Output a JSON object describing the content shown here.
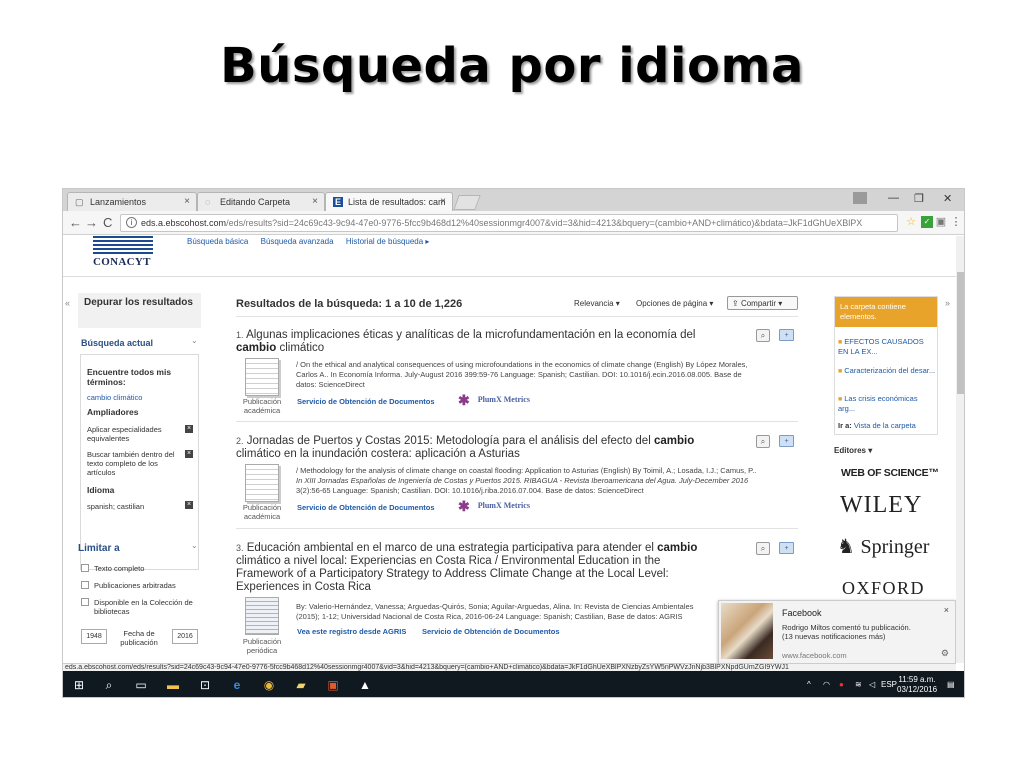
{
  "slide": {
    "title": "Búsqueda por idioma"
  },
  "browser": {
    "tabs": [
      {
        "label": "Lanzamientos",
        "close": "×"
      },
      {
        "label": "Editando Carpeta",
        "close": "×"
      },
      {
        "label": "Lista de resultados: cam",
        "close": "×"
      }
    ],
    "window_controls": {
      "minimize": "—",
      "maximize": "❐",
      "close": "✕"
    },
    "nav": {
      "back": "←",
      "forward": "→",
      "reload": "C"
    },
    "url_host": "eds.a.ebscohost.com",
    "url_path": "/eds/results?sid=24c69c43-9c94-47e0-9776-5fcc9b468d12%40sessionmgr4007&vid=3&hid=4213&bquery=(cambio+AND+climático)&bdata=JkF1dGhUeXBlPX"
  },
  "site": {
    "logo_text": "CONACYT",
    "top_links": [
      "Búsqueda básica",
      "Búsqueda avanzada",
      "Historial de búsqueda ▸"
    ]
  },
  "sidebar": {
    "collapse": "«",
    "refine_title": "Depurar los resultados",
    "current_search_title": "Búsqueda actual",
    "find_all_label": "Encuentre todos mis términos:",
    "term": "cambio climático",
    "expanders_label": "Ampliadores",
    "expanders": [
      "Aplicar especialidades equivalentes",
      "Buscar también dentro del texto completo de los artículos"
    ],
    "language_label": "Idioma",
    "language_value": "spanish; castilian",
    "limit_title": "Limitar a",
    "limits": [
      "Texto completo",
      "Publicaciones arbitradas",
      "Disponible en la Colección de bibliotecas"
    ],
    "year_from": "1948",
    "year_label": "Fecha de publicación",
    "year_to": "2016",
    "caret": "⌄",
    "remove": "×"
  },
  "results": {
    "header": "Resultados de la búsqueda: 1 a 10 de 1,226",
    "sort": "Relevancia ▾",
    "page_options": "Opciones de página ▾",
    "share": "Compartir ▾",
    "items": [
      {
        "num": "1.",
        "title_a": "Algunas implicaciones éticas y analíticas de la microfundamentación en la economía del ",
        "title_bold": "cambio",
        "title_b": " climático",
        "meta_1": "/ On the ethical and analytical consequences of using microfoundations in the economics of climate change (English) By López Morales,",
        "meta_2": "Carlos A.. In Economía Informa. July-August 2016 399:59-76 Language: Spanish; Castilian. DOI: 10.1016/j.ecin.2016.08.005. Base de",
        "meta_3": "datos: ScienceDirect",
        "pubtype": "Publicación académica",
        "link_1": "Servicio de Obtención de Documentos",
        "link_2": "PlumX Metrics"
      },
      {
        "num": "2.",
        "title_a": "Jornadas de Puertos y Costas 2015: Metodología para el análisis del efecto del ",
        "title_bold": "cambio",
        "title_b": " climático en la inundación costera: aplicación a Asturias",
        "meta_1": "/ Methodology for the analysis of climate change on coastal flooding: Application to Asturias (English) By Toimil, A.; Losada, I.J.; Camus, P..",
        "meta_2": "In XIII Jornadas Españolas de Ingeniería de Costas y Puertos 2015. RIBAGUA - Revista Iberoamericana del Agua. July-December 2016",
        "meta_3": "3(2):56-65 Language: Spanish; Castilian. DOI: 10.1016/j.riba.2016.07.004. Base de datos: ScienceDirect",
        "pubtype": "Publicación académica",
        "link_1": "Servicio de Obtención de Documentos",
        "link_2": "PlumX Metrics"
      },
      {
        "num": "3.",
        "title_a": "Educación ambiental en el marco de una estrategia participativa para atender el ",
        "title_bold": "cambio",
        "title_b": " climático a nivel local: Experiencias en Costa Rica / Environmental Education in the Framework of a Participatory Strategy to Address Climate Change at the Local Level: Experiences in Costa Rica",
        "meta_1": "By: Valerio-Hernández, Vanessa; Arguedas-Quirós, Sonia; Aguilar-Arguedas, Alina. In: Revista de Ciencias Ambientales",
        "meta_2": "(2015); 1-12; Universidad Nacional de Costa Rica, 2016-06-24 Language: Spanish; Castilian, Base de datos: AGRIS",
        "meta_3": "",
        "pubtype": "Publicación periódica",
        "link_1": "Vea este registro desde AGRIS",
        "link_2": "Servicio de Obtención de Documentos"
      }
    ]
  },
  "folder": {
    "header": "La carpeta contiene elementos.",
    "items": [
      "EFECTOS CAUSADOS EN LA EX...",
      "Caracterización del desar...",
      "Las crisis económicas arg..."
    ],
    "footer_prefix": "Ir a: ",
    "footer_link": "Vista de la carpeta",
    "collapse": "»"
  },
  "editors": {
    "label": "Editores ▾",
    "logos": [
      "WEB OF SCIENCE™",
      "WILEY",
      "Springer",
      "OXFORD"
    ]
  },
  "notification": {
    "title": "Facebook",
    "line_1": "Rodrigo Miltos comentó tu publicación.",
    "line_2": "(13 nuevas notificaciones más)",
    "source": "www.facebook.com",
    "close": "×",
    "gear": "⚙"
  },
  "status_url": "eds.a.ebscohost.com/eds/results?sid=24c69c43-9c94-47e0-9776-5fcc9b468d12%40sessionmgr4007&vid=3&hid=4213&bquery=(cambio+AND+climático)&bdata=JkF1dGhUeXBlPXNzbyZsYW5nPWVzJnNjb3BlPXNpdGUmZGI9YWJ1",
  "taskbar": {
    "tray_language": "ESP",
    "tray_caret": "^",
    "time": "11:59 a.m.",
    "date": "03/12/2016"
  }
}
